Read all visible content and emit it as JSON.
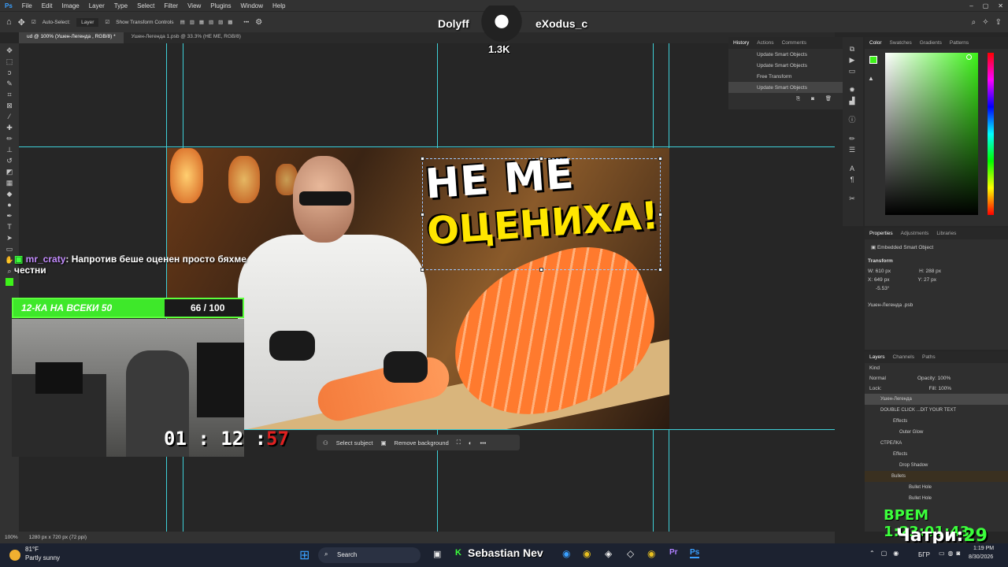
{
  "menu": [
    "File",
    "Edit",
    "Image",
    "Layer",
    "Type",
    "Select",
    "Filter",
    "View",
    "Plugins",
    "Window",
    "Help"
  ],
  "options": {
    "auto_select": "Auto-Select:",
    "layer_select": "Layer",
    "transform_controls": "Show Transform Controls"
  },
  "doc_tabs": [
    "ud @ 100% (Ушен-Легенда , RGB/8) *",
    "Ушен-Легенда 1.psb @ 33.3% (НЕ МЕ, RGB/8)"
  ],
  "thumbnail": {
    "line1": "НЕ МЕ",
    "line2": "ОЦЕНИХА!"
  },
  "context_bar": {
    "select_subject": "Select subject",
    "remove_background": "Remove background"
  },
  "stream": {
    "left_name": "Dolyff",
    "right_name": "eXodus_c",
    "counter": "1.3K",
    "chat_user": "mr_craty",
    "chat_message": ": Напротив беше оценен просто бяхме честни",
    "goal_label": "12-КА НА ВСЕКИ 50",
    "goal_count": "66 / 100",
    "goal_fraction": 0.66,
    "timer_main": "01 : 12 :",
    "timer_red": "57",
    "clock": "ВРЕМ 1:23:01:43",
    "day": "Чатри:",
    "day_num": "29"
  },
  "history": {
    "tabs": [
      "History",
      "Actions",
      "Comments"
    ],
    "items": [
      "Update Smart Objects",
      "Update Smart Objects",
      "Free Transform",
      "Update Smart Objects"
    ]
  },
  "color_panel": {
    "tabs": [
      "Color",
      "Swatches",
      "Gradients",
      "Patterns"
    ],
    "fg": "#3ef21a"
  },
  "properties": {
    "tabs": [
      "Properties",
      "Adjustments",
      "Libraries"
    ],
    "kind": "Embedded Smart Object",
    "section": "Transform",
    "w": "W: 610 px",
    "h": "H: 288 px",
    "x": "X: 649 px",
    "y": "Y: 27 px",
    "angle": "-5.53°",
    "file": "Ушен-Легенда .psb"
  },
  "layers": {
    "tabs": [
      "Layers",
      "Channels",
      "Paths"
    ],
    "kind": "Kind",
    "blend": "Normal",
    "opacity": "Opacity: 100%",
    "lock": "Lock:",
    "fill": "Fill: 100%",
    "items": [
      "Ушен-Легенда",
      "DOUBLE CLICK ...DIT YOUR TEXT",
      "Effects",
      "Outer Glow",
      "СТРЕЛКА",
      "Effects",
      "Drop Shadow",
      "Bullets",
      "Bullet Hole",
      "Bullet Hole"
    ]
  },
  "status": {
    "zoom": "100%",
    "size": "1280 px x 720 px (72 ppi)"
  },
  "taskbar": {
    "temp": "81°F",
    "weather": "Partly sunny",
    "search": "Search",
    "app_title": "Sebastian Nev",
    "lang": "БГР",
    "time": "1:19 PM",
    "date": "8/30/2026"
  }
}
